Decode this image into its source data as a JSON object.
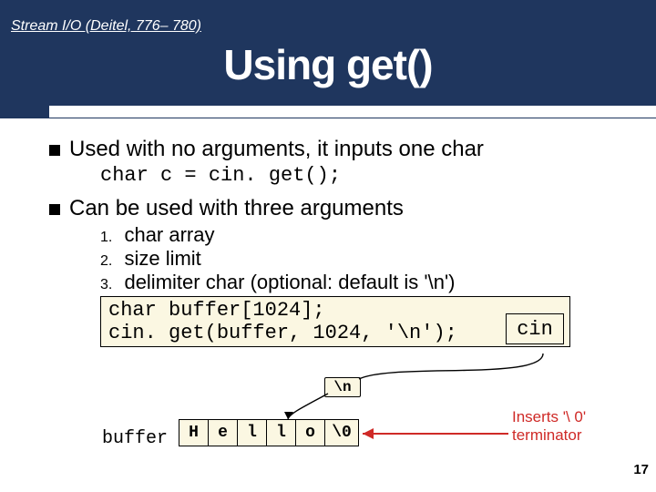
{
  "header": {
    "breadcrumb": "Stream I/O (Deitel, 776– 780)",
    "title": "Using get()"
  },
  "bullets": {
    "b1": "Used with no arguments, it inputs one char",
    "b1_code": "char c = cin. get();",
    "b2": "Can be used with three arguments"
  },
  "args": {
    "i1": {
      "n": "1.",
      "t": "char array"
    },
    "i2": {
      "n": "2.",
      "t": "size limit"
    },
    "i3": {
      "n": "3.",
      "t": "delimiter char (optional: default is '\\n')"
    }
  },
  "codebox": {
    "l1": "char buffer[1024];",
    "l2": "cin. get(buffer, 1024, '\\n');",
    "cin_label": "cin"
  },
  "diagram": {
    "newline": "\\n",
    "buffer_label": "buffer",
    "cells": [
      "H",
      "e",
      "l",
      "l",
      "o",
      "\\0"
    ],
    "note_l1": "Inserts '\\ 0'",
    "note_l2": "terminator"
  },
  "page_number": "17"
}
